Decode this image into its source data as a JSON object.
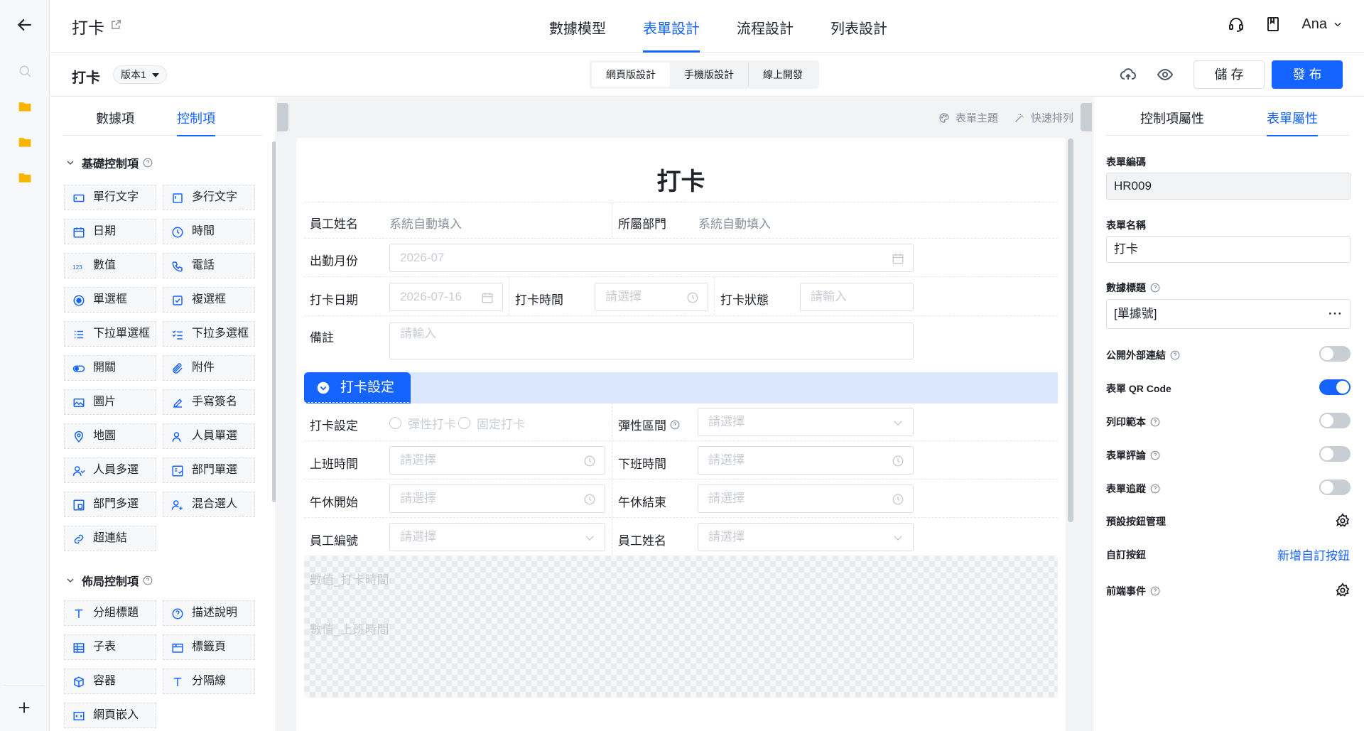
{
  "header": {
    "app_title": "打卡",
    "tabs": [
      {
        "label": "數據模型"
      },
      {
        "label": "表單設計"
      },
      {
        "label": "流程設計"
      },
      {
        "label": "列表設計"
      }
    ],
    "user": "Ana"
  },
  "subbar": {
    "title": "打卡",
    "version": "版本1",
    "segments": [
      "網頁版設計",
      "手機版設計",
      "線上開發"
    ],
    "save_label": "儲 存",
    "publish_label": "發 布"
  },
  "palette": {
    "tabs": [
      "數據項",
      "控制項"
    ],
    "basic_title": "基礎控制項",
    "basic": [
      "單行文字",
      "多行文字",
      "日期",
      "時間",
      "數值",
      "電話",
      "單選框",
      "複選框",
      "下拉單選框",
      "下拉多選框",
      "開關",
      "附件",
      "圖片",
      "手寫簽名",
      "地圖",
      "人員單選",
      "人員多選",
      "部門單選",
      "部門多選",
      "混合選人",
      "超連結"
    ],
    "layout_title": "佈局控制項",
    "layout": [
      "分組標題",
      "描述說明",
      "子表",
      "標籤頁",
      "容器",
      "分隔線",
      "網頁嵌入"
    ]
  },
  "canvas": {
    "tools": [
      "表單主題",
      "快速排列"
    ],
    "form_title": "打卡",
    "fields": {
      "employee_name_label": "員工姓名",
      "employee_name_value": "系統自動填入",
      "department_label": "所屬部門",
      "department_value": "系統自動填入",
      "month_label": "出勤月份",
      "month_value": "2026-07",
      "date_label": "打卡日期",
      "date_value": "2026-07-16",
      "time_label": "打卡時間",
      "time_placeholder": "請選擇",
      "status_label": "打卡狀態",
      "status_placeholder": "請輸入",
      "remark_label": "備註",
      "remark_placeholder": "請輸入"
    },
    "group_title": "打卡設定",
    "group_fields": {
      "setting_label": "打卡設定",
      "radio1": "彈性打卡",
      "radio2": "固定打卡",
      "flex_label": "彈性區間",
      "flex_placeholder": "請選擇",
      "start_label": "上班時間",
      "start_placeholder": "請選擇",
      "end_label": "下班時間",
      "end_placeholder": "請選擇",
      "lunch_start_label": "午休開始",
      "lunch_start_placeholder": "請選擇",
      "lunch_end_label": "午休結束",
      "lunch_end_placeholder": "請選擇",
      "emp_no_label": "員工編號",
      "emp_no_placeholder": "請選擇",
      "emp_name_label": "員工姓名",
      "emp_name_placeholder": "請選擇"
    },
    "hidden_fields": [
      "數值_打卡時間",
      "數值_上班時間"
    ]
  },
  "props": {
    "tabs": [
      "控制項屬性",
      "表單屬性"
    ],
    "code_label": "表單編碼",
    "code_value": "HR009",
    "name_label": "表單名稱",
    "name_value": "打卡",
    "data_title_label": "數據標題",
    "data_title_value": "[單據號]",
    "dots": "···",
    "public_link_label": "公開外部連結",
    "qr_label": "表單 QR Code",
    "print_label": "列印範本",
    "comment_label": "表單評論",
    "track_label": "表單追蹤",
    "default_btn_label": "預設按鈕管理",
    "custom_btn_label": "自訂按鈕",
    "custom_btn_link": "新增自訂按鈕",
    "frontend_label": "前端事件",
    "toggles": {
      "public_link": false,
      "qr": true,
      "print": false,
      "comment": false,
      "track": false
    }
  },
  "colors": {
    "accent": "#1664ff",
    "folder": "#f7b500"
  }
}
